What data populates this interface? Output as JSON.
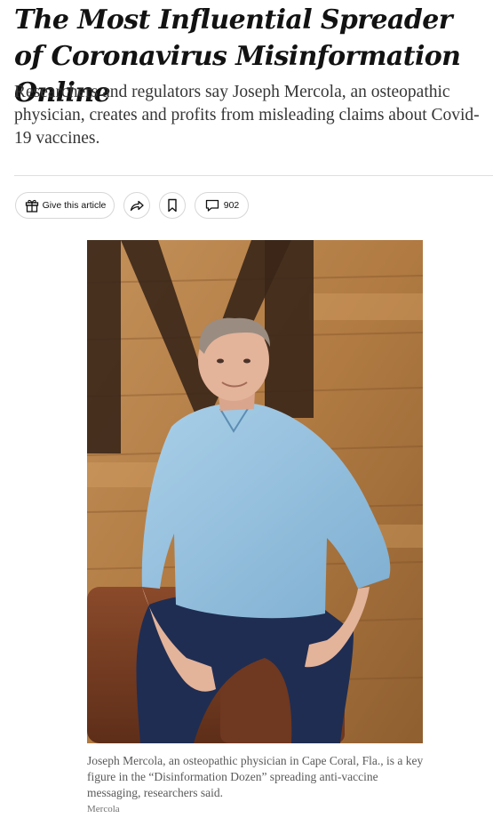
{
  "article": {
    "headline": "The Most Influential Spreader of Coronavirus Misinformation Online",
    "summary": "Researchers and regulators say Joseph Mercola, an osteopathic physician, creates and profits from misleading claims about Covid-19 vaccines."
  },
  "toolbar": {
    "gift_label": "Give this article",
    "gift_icon": "gift-icon",
    "share_icon": "share-arrow-icon",
    "bookmark_icon": "bookmark-icon",
    "comment_icon": "comment-icon",
    "comment_count": "902"
  },
  "media": {
    "photo_description_icon": "portrait-photo",
    "caption": "Joseph Mercola, an osteopathic physician in Cape Coral, Fla., is a key figure in the “Disinformation Dozen” spreading anti-vaccine messaging, researchers said.",
    "credit": "Mercola"
  },
  "colors": {
    "text": "#121212",
    "summary_text": "#363636",
    "caption_text": "#5a5a5a",
    "border": "#d7d7d7"
  }
}
